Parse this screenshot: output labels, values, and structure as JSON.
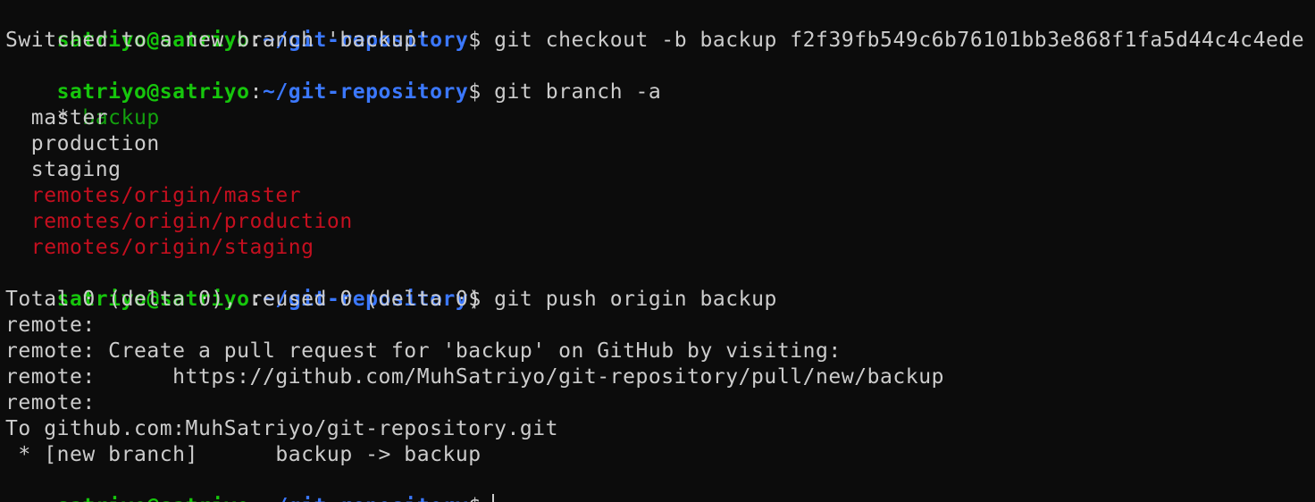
{
  "terminal": {
    "prompt": {
      "user_host": "satriyo@satriyo",
      "colon": ":",
      "path": "~/git-repository",
      "symbol": "$"
    },
    "commands": [
      " git checkout -b backup f2f39fb549c6b76101bb3e868f1fa5d44c4c4ede",
      " git branch -a",
      " git push origin backup"
    ],
    "checkout_output": "Switched to a new branch 'backup'",
    "branch_list": {
      "current_marker": "* ",
      "current": "backup",
      "local": [
        "  master",
        "  production",
        "  staging"
      ],
      "remote": [
        "  remotes/origin/master",
        "  remotes/origin/production",
        "  remotes/origin/staging"
      ]
    },
    "push_output": [
      "Total 0 (delta 0), reused 0 (delta 0)",
      "remote:",
      "remote: Create a pull request for 'backup' on GitHub by visiting:",
      "remote:      https://github.com/MuhSatriyo/git-repository/pull/new/backup",
      "remote:",
      "To github.com:MuhSatriyo/git-repository.git",
      " * [new branch]      backup -> backup"
    ]
  },
  "colors": {
    "background": "#0c0c0c",
    "foreground": "#cccccc",
    "prompt_user": "#16c60c",
    "prompt_path": "#3b78ff",
    "current_branch": "#13a10e",
    "remote_branch": "#c50f1f"
  }
}
